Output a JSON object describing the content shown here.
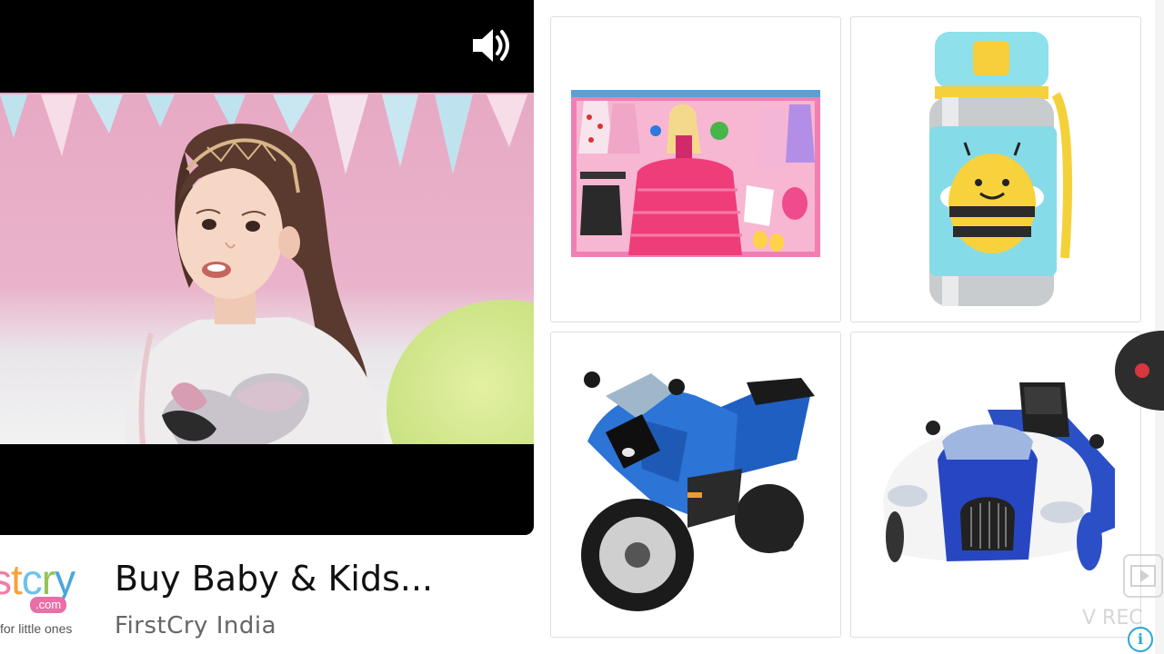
{
  "video": {
    "mute_icon": "volume-icon"
  },
  "ad": {
    "title": "Buy Baby & Kids...",
    "advertiser": "FirstCry India",
    "logo": {
      "word_s": "s",
      "word_t": "t",
      "word_c": "c",
      "word_r": "r",
      "word_y": "y",
      "domain": ".com",
      "tagline": "for little ones"
    }
  },
  "products": [
    {
      "icon": "doll-playset-icon"
    },
    {
      "icon": "bee-water-bottle-icon"
    },
    {
      "icon": "ride-on-motorcycle-icon"
    },
    {
      "icon": "ride-on-car-icon"
    }
  ],
  "overlay": {
    "watermark": "V REC",
    "info": "i"
  },
  "colors": {
    "brand_pink": "#ec6ea6",
    "info_blue": "#2aa5d8",
    "record_red": "#d9363e"
  }
}
